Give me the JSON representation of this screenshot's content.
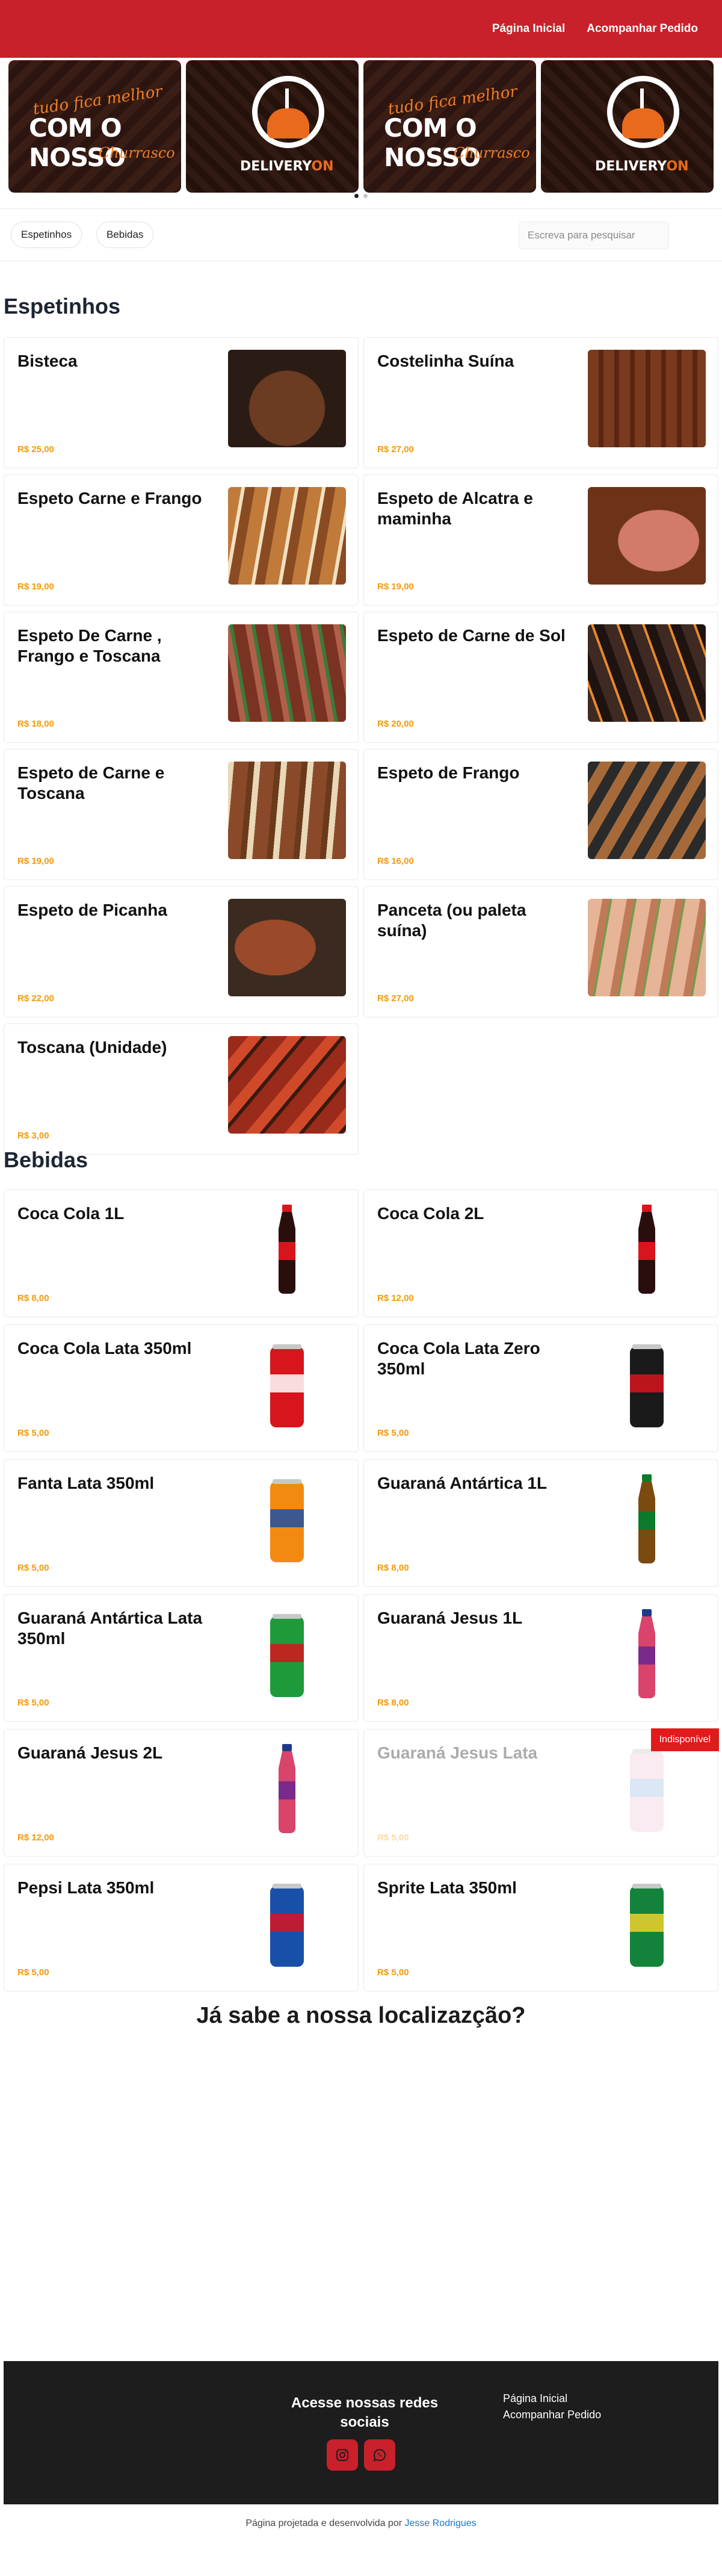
{
  "nav": {
    "home": "Página Inicial",
    "track": "Acompanhar Pedido"
  },
  "banners": {
    "promo_line1": "tudo fica melhor",
    "promo_line2": "COM O NOSSO",
    "promo_line3": "Churrasco",
    "delivery_a": "DELIVERY",
    "delivery_b": "ON"
  },
  "filters": {
    "chips": [
      "Espetinhos",
      "Bebidas"
    ],
    "search_placeholder": "Escreva para pesquisar"
  },
  "sections": {
    "espetinhos": "Espetinhos",
    "bebidas": "Bebidas"
  },
  "espetinhos": [
    {
      "name": "Bisteca",
      "price": "R$ 25,00"
    },
    {
      "name": "Costelinha Suína",
      "price": "R$ 27,00"
    },
    {
      "name": "Espeto Carne e Frango",
      "price": "R$ 19,00"
    },
    {
      "name": "Espeto de Alcatra e maminha",
      "price": "R$ 19,00"
    },
    {
      "name": "Espeto De Carne , Frango e Toscana",
      "price": "R$ 18,00"
    },
    {
      "name": "Espeto de Carne de Sol",
      "price": "R$ 20,00"
    },
    {
      "name": "Espeto de Carne e Toscana",
      "price": "R$ 19,00"
    },
    {
      "name": "Espeto de Frango",
      "price": "R$ 16,00"
    },
    {
      "name": "Espeto de Picanha",
      "price": "R$ 22,00"
    },
    {
      "name": "Panceta (ou paleta suína)",
      "price": "R$ 27,00"
    },
    {
      "name": "Toscana (Unidade)",
      "price": "R$ 3,00"
    }
  ],
  "bebidas": [
    {
      "name": "Coca Cola 1L",
      "price": "R$ 8,00"
    },
    {
      "name": "Coca Cola 2L",
      "price": "R$ 12,00"
    },
    {
      "name": "Coca Cola Lata 350ml",
      "price": "R$ 5,00"
    },
    {
      "name": "Coca Cola Lata Zero 350ml",
      "price": "R$ 5,00"
    },
    {
      "name": "Fanta Lata 350ml",
      "price": "R$ 5,00"
    },
    {
      "name": "Guaraná Antártica 1L",
      "price": "R$ 8,00"
    },
    {
      "name": "Guaraná Antártica Lata 350ml",
      "price": "R$ 5,00"
    },
    {
      "name": "Guaraná Jesus 1L",
      "price": "R$ 8,00"
    },
    {
      "name": "Guaraná Jesus 2L",
      "price": "R$ 12,00"
    },
    {
      "name": "Guaraná Jesus Lata",
      "price": "R$ 5,00",
      "badge": "Indisponível"
    },
    {
      "name": "Pepsi Lata 350ml",
      "price": "R$ 5,00"
    },
    {
      "name": "Sprite Lata 350ml",
      "price": "R$ 5,00"
    }
  ],
  "location_title": "Já sabe a nossa localizazção?",
  "footer": {
    "social_heading": "Acesse nossas redes sociais",
    "links": [
      "Página Inicial",
      "Acompanhar Pedido"
    ]
  },
  "credit": {
    "text": "Página projetada e desenvolvida por ",
    "author": "Jesse Rodrigues"
  },
  "colors": {
    "brand_red": "#c8212b",
    "price_orange": "#f39a0c",
    "footer_bg": "#1d1d1d"
  }
}
